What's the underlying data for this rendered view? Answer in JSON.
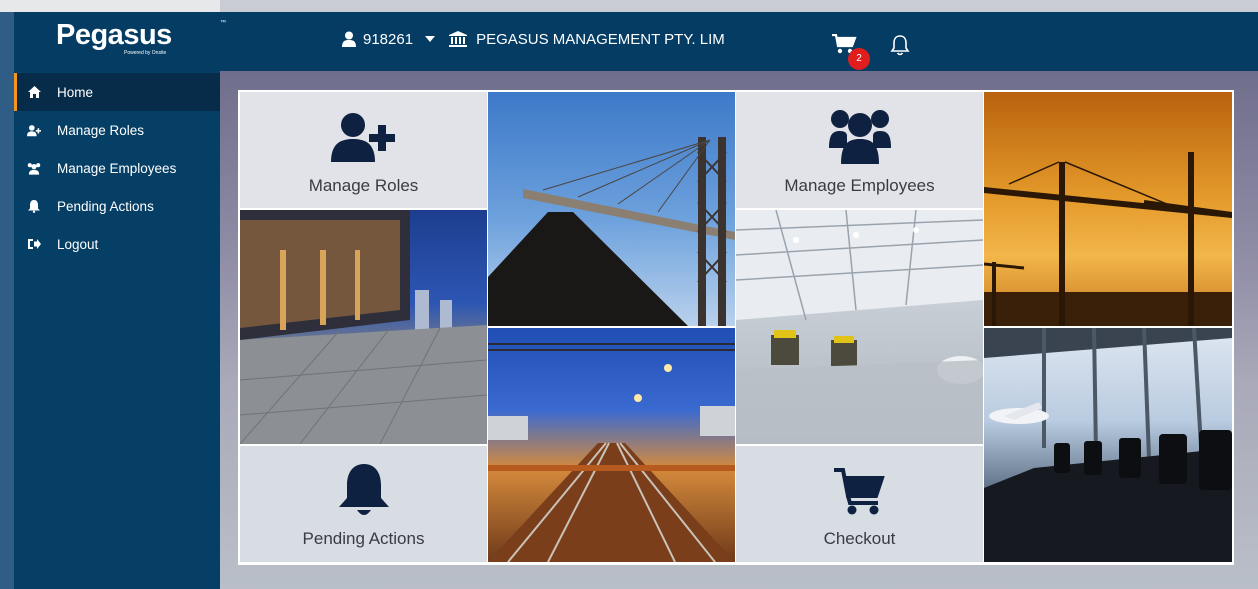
{
  "brand": {
    "name": "Pegasus",
    "tagline": "Powered by Onsite",
    "trademark": "™"
  },
  "header": {
    "user_id": "918261",
    "company": "PEGASUS MANAGEMENT PTY. LIM",
    "cart_count": "2"
  },
  "sidebar": {
    "items": [
      {
        "label": "Home",
        "icon": "home-icon",
        "active": true
      },
      {
        "label": "Manage Roles",
        "icon": "user-plus-icon"
      },
      {
        "label": "Manage Employees",
        "icon": "users-icon"
      },
      {
        "label": "Pending Actions",
        "icon": "bell-icon"
      },
      {
        "label": "Logout",
        "icon": "sign-out-icon"
      }
    ]
  },
  "tiles": {
    "manage_roles": {
      "label": "Manage Roles",
      "icon": "user-plus-icon"
    },
    "manage_employees": {
      "label": "Manage Employees",
      "icon": "users-icon"
    },
    "pending_actions": {
      "label": "Pending Actions",
      "icon": "bell-icon"
    },
    "checkout": {
      "label": "Checkout",
      "icon": "cart-icon"
    }
  },
  "colors": {
    "header": "#043c64",
    "sidebar": "#063f66",
    "active_accent": "#f7941d",
    "badge": "#e01e1e",
    "tile_icon": "#0f2140"
  }
}
